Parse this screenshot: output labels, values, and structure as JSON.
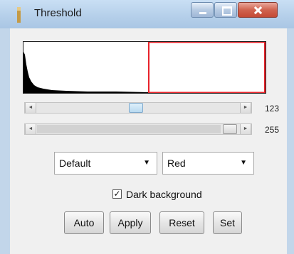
{
  "window": {
    "title": "Threshold"
  },
  "icons": {
    "app": "threshold-app-icon",
    "minimize": "minimize-icon",
    "maximize": "maximize-icon",
    "close": "close-icon",
    "scroll_left": "scroll-left-arrow-icon",
    "scroll_right": "scroll-right-arrow-icon",
    "dropdown": "chevron-down-icon"
  },
  "colors": {
    "histogram_fill": "#000000",
    "threshold_overlay": "#e8232a"
  },
  "sliders": {
    "min": {
      "value": "123",
      "arrow_left": "◄",
      "arrow_right": "►"
    },
    "max": {
      "value": "255",
      "arrow_left": "◄",
      "arrow_right": "►"
    }
  },
  "method_select": {
    "selected": "Default",
    "arrow": "▼"
  },
  "display_select": {
    "selected": "Red",
    "arrow": "▼"
  },
  "dark_background": {
    "label": "Dark background",
    "checked": true,
    "mark": "✓"
  },
  "buttons": {
    "auto": "Auto",
    "apply": "Apply",
    "reset": "Reset",
    "set": "Set"
  }
}
